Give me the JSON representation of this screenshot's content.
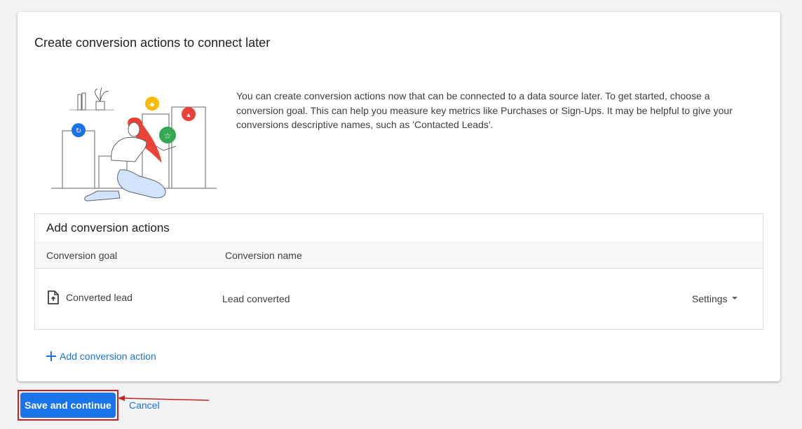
{
  "card": {
    "title": "Create conversion actions to connect later",
    "intro": "You can create conversion actions now that can be connected to a data source later. To get started, choose a conversion goal. This can help you measure key metrics like Purchases or Sign-Ups. It may be helpful to give your conversions descriptive names, such as 'Contacted Leads'."
  },
  "table": {
    "title": "Add conversion actions",
    "columns": {
      "goal": "Conversion goal",
      "name": "Conversion name"
    },
    "rows": [
      {
        "goal": "Converted lead",
        "goal_icon": "document-upload-icon",
        "name": "Lead converted",
        "settings_label": "Settings"
      }
    ]
  },
  "add_action_label": "Add conversion action",
  "footer": {
    "save_label": "Save and continue",
    "cancel_label": "Cancel"
  },
  "colors": {
    "accent": "#1a73e8",
    "highlight": "#c5221f"
  }
}
